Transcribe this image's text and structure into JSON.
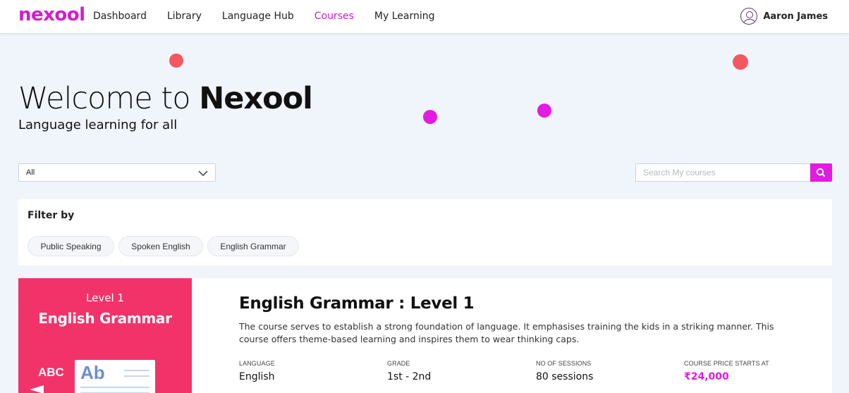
{
  "header": {
    "logo": "nexool",
    "nav": [
      {
        "label": "Dashboard"
      },
      {
        "label": "Library"
      },
      {
        "label": "Language Hub"
      },
      {
        "label": "Courses",
        "active": true
      },
      {
        "label": "My Learning"
      }
    ],
    "user_name": "Aaron James"
  },
  "hero": {
    "title_light": "Welcome to",
    "title_bold": "Nexool",
    "subtitle": "Language learning for all"
  },
  "controls": {
    "select_value": "All",
    "search_placeholder": "Search My courses"
  },
  "filter": {
    "label": "Filter by",
    "chips": [
      "Public Speaking",
      "Spoken English",
      "English Grammar"
    ]
  },
  "course": {
    "thumb_level": "Level 1",
    "thumb_title": "English Grammar",
    "thumb_abc": "ABC",
    "thumb_ab": "Ab",
    "title": "English Grammar : Level 1",
    "description": "The course serves to establish a strong foundation of language. It emphasises training the kids in a striking manner. This course offers theme-based learning and inspires them to wear thinking caps.",
    "meta": [
      {
        "label": "LANGUAGE",
        "value": "English"
      },
      {
        "label": "GRADE",
        "value": "1st - 2nd"
      },
      {
        "label": "NO OF SESSIONS",
        "value": "80 sessions"
      },
      {
        "label": "COURSE PRICE STARTS AT",
        "value": "₹24,000"
      }
    ]
  },
  "colors": {
    "accent": "#e31be0",
    "logo": "#d51bd0",
    "dot_red": "#f55760",
    "thumb_bg": "#f2336a",
    "page_bg": "#f0f5fc"
  }
}
